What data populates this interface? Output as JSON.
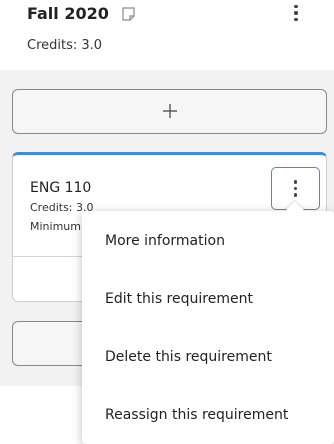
{
  "term": {
    "title": "Fall 2020",
    "credits": "Credits:  3.0"
  },
  "requirement": {
    "code": "ENG 110",
    "credits": "Credits: 3.0",
    "minimum_truncated": "Minimum"
  },
  "menu": {
    "items": [
      {
        "label": "More information"
      },
      {
        "label": "Edit this requirement"
      },
      {
        "label": "Delete this requirement"
      },
      {
        "label": "Reassign this requirement"
      }
    ]
  },
  "icons": {
    "note": "note-icon",
    "term_options": "vertical-ellipsis-icon",
    "add": "plus-icon",
    "requirement_options": "vertical-ellipsis-icon"
  },
  "colors": {
    "accent": "#3a8de0",
    "panel_bg": "#f2f2f2"
  }
}
